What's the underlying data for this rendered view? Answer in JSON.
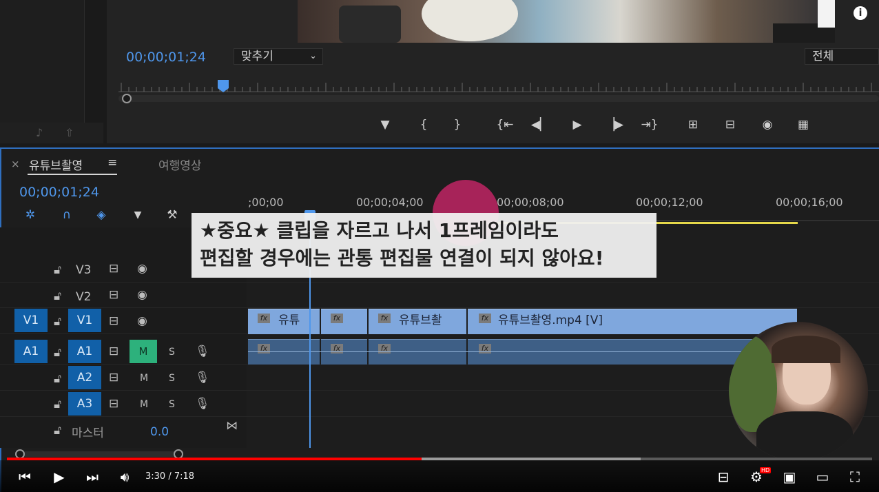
{
  "program_monitor": {
    "timecode": "00;00;01;24",
    "fit_label": "맞추기",
    "fit_chevron": "⌄",
    "full_label": "전체",
    "info_icon": "i"
  },
  "controls": [
    "▼",
    "{",
    "}",
    "{⇤",
    "◀▏",
    "▶",
    "▕▶",
    "⇥}",
    "⊞",
    "⊟",
    "◉",
    "▦"
  ],
  "timeline": {
    "tabs": {
      "active": "유튜브촬영",
      "other": "여행영상"
    },
    "close": "×",
    "menu": "≡",
    "timecode": "00;00;01;24",
    "ruler": [
      ";00;00",
      "00;00;04;00",
      "00;00;08;00",
      "00;00;12;00",
      "00;00;16;00"
    ],
    "tracks": {
      "v3": "V3",
      "v2": "V2",
      "v1_src": "V1",
      "v1": "V1",
      "a1_src": "A1",
      "a1": "A1",
      "a2": "A2",
      "a3": "A3",
      "m": "M",
      "s": "S",
      "master": "마스터",
      "master_val": "0.0"
    },
    "clips_v": [
      "유튜",
      "",
      "유튜브촬",
      "유튜브촬영.mp4 [V]"
    ],
    "fx": "fx"
  },
  "subtitle": {
    "line1": "★중요★ 클립을 자르고 나서 1프레임이라도",
    "line2": "편집할 경우에는 관통 편집물 연결이 되지 않아요!"
  },
  "player": {
    "time": "3:30 / 7:18",
    "progress_fraction": 0.479,
    "hd": "HD"
  }
}
